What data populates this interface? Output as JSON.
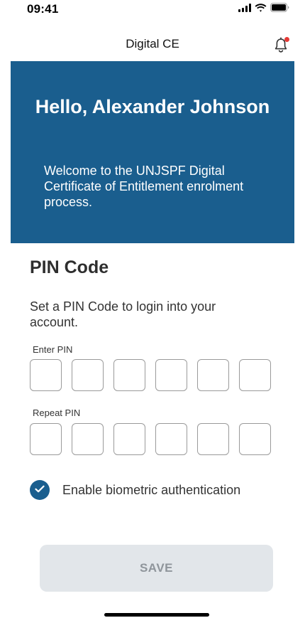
{
  "status_bar": {
    "time": "09:41",
    "icons": [
      "cellular-signal-icon",
      "wifi-icon",
      "battery-icon"
    ]
  },
  "nav": {
    "title": "Digital CE",
    "notification_icon": "bell-icon",
    "notification_badge_color": "#e53935"
  },
  "hero": {
    "greeting": "Hello, Alexander Johnson",
    "message": "Welcome to the UNJSPF Digital Certificate of Entitlement enrolment process.",
    "background_color": "#1a5e8e"
  },
  "pin_section": {
    "title": "PIN Code",
    "description": "Set a PIN Code to login into your account.",
    "enter_label": "Enter PIN",
    "repeat_label": "Repeat PIN",
    "enter_digits": [
      "",
      "",
      "",
      "",
      "",
      ""
    ],
    "repeat_digits": [
      "",
      "",
      "",
      "",
      "",
      ""
    ]
  },
  "biometric": {
    "label": "Enable biometric authentication",
    "checked": true,
    "check_icon": "checkmark-icon"
  },
  "save_button": {
    "label": "SAVE",
    "enabled": false
  }
}
